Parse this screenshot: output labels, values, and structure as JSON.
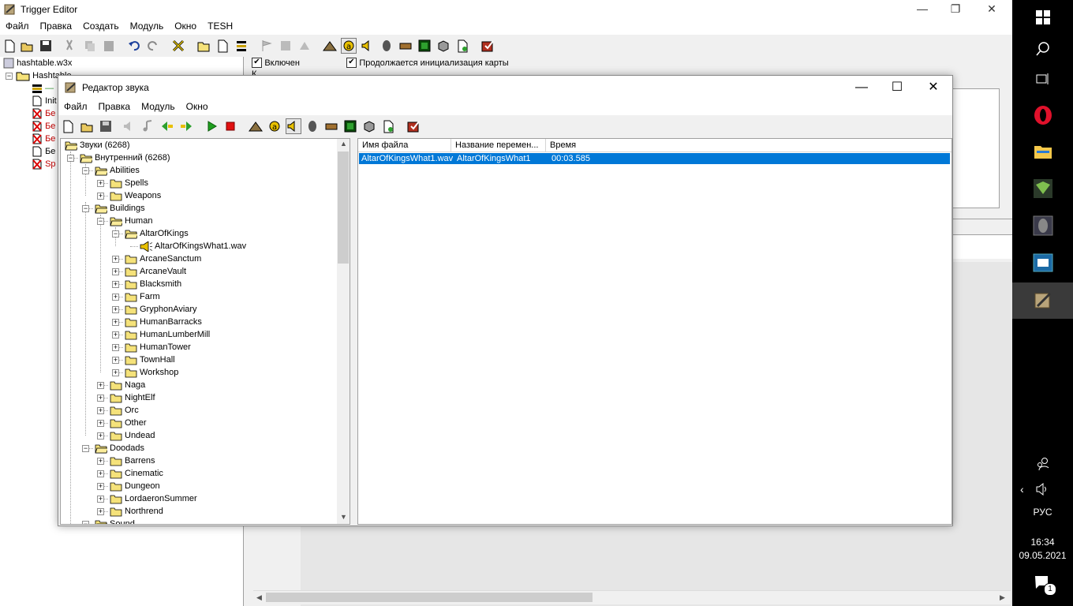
{
  "main": {
    "title": "Trigger Editor",
    "menu": [
      "Файл",
      "Правка",
      "Создать",
      "Модуль",
      "Окно",
      "TESH"
    ],
    "tree": {
      "root": "hashtable.w3x",
      "category": "Hashtable",
      "items": [
        {
          "label": "—",
          "color": "#2e8b2e"
        },
        {
          "label": "Init",
          "color": "#000000"
        },
        {
          "label": "Бе",
          "color": "#c00000"
        },
        {
          "label": "Бе",
          "color": "#c00000"
        },
        {
          "label": "Бе",
          "color": "#c00000"
        },
        {
          "label": "Бе",
          "color": "#000000"
        },
        {
          "label": "Sp",
          "color": "#c00000"
        }
      ]
    },
    "checkbox_enabled": "Включен",
    "checkbox_init": "Продолжается инициализация карты",
    "comment_label": "К"
  },
  "dialog": {
    "title": "Редактор звука",
    "menu": [
      "Файл",
      "Правка",
      "Модуль",
      "Окно"
    ],
    "tree": [
      {
        "label": "Звуки (6268)",
        "level": 0,
        "expander": "",
        "type": "folder-open"
      },
      {
        "label": "Внутренний (6268)",
        "level": 1,
        "expander": "-",
        "type": "folder-open"
      },
      {
        "label": "Abilities",
        "level": 2,
        "expander": "-",
        "type": "folder-open"
      },
      {
        "label": "Spells",
        "level": 3,
        "expander": "+",
        "type": "folder"
      },
      {
        "label": "Weapons",
        "level": 3,
        "expander": "+",
        "type": "folder"
      },
      {
        "label": "Buildings",
        "level": 2,
        "expander": "-",
        "type": "folder-open"
      },
      {
        "label": "Human",
        "level": 3,
        "expander": "-",
        "type": "folder-open"
      },
      {
        "label": "AltarOfKings",
        "level": 4,
        "expander": "-",
        "type": "folder-open"
      },
      {
        "label": "AltarOfKingsWhat1.wav",
        "level": 5,
        "expander": "",
        "type": "sound"
      },
      {
        "label": "ArcaneSanctum",
        "level": 4,
        "expander": "+",
        "type": "folder"
      },
      {
        "label": "ArcaneVault",
        "level": 4,
        "expander": "+",
        "type": "folder"
      },
      {
        "label": "Blacksmith",
        "level": 4,
        "expander": "+",
        "type": "folder"
      },
      {
        "label": "Farm",
        "level": 4,
        "expander": "+",
        "type": "folder"
      },
      {
        "label": "GryphonAviary",
        "level": 4,
        "expander": "+",
        "type": "folder"
      },
      {
        "label": "HumanBarracks",
        "level": 4,
        "expander": "+",
        "type": "folder"
      },
      {
        "label": "HumanLumberMill",
        "level": 4,
        "expander": "+",
        "type": "folder"
      },
      {
        "label": "HumanTower",
        "level": 4,
        "expander": "+",
        "type": "folder"
      },
      {
        "label": "TownHall",
        "level": 4,
        "expander": "+",
        "type": "folder"
      },
      {
        "label": "Workshop",
        "level": 4,
        "expander": "+",
        "type": "folder"
      },
      {
        "label": "Naga",
        "level": 3,
        "expander": "+",
        "type": "folder"
      },
      {
        "label": "NightElf",
        "level": 3,
        "expander": "+",
        "type": "folder"
      },
      {
        "label": "Orc",
        "level": 3,
        "expander": "+",
        "type": "folder"
      },
      {
        "label": "Other",
        "level": 3,
        "expander": "+",
        "type": "folder"
      },
      {
        "label": "Undead",
        "level": 3,
        "expander": "+",
        "type": "folder"
      },
      {
        "label": "Doodads",
        "level": 2,
        "expander": "-",
        "type": "folder-open"
      },
      {
        "label": "Barrens",
        "level": 3,
        "expander": "+",
        "type": "folder"
      },
      {
        "label": "Cinematic",
        "level": 3,
        "expander": "+",
        "type": "folder"
      },
      {
        "label": "Dungeon",
        "level": 3,
        "expander": "+",
        "type": "folder"
      },
      {
        "label": "LordaeronSummer",
        "level": 3,
        "expander": "+",
        "type": "folder"
      },
      {
        "label": "Northrend",
        "level": 3,
        "expander": "+",
        "type": "folder"
      },
      {
        "label": "Sound",
        "level": 2,
        "expander": "-",
        "type": "folder-open"
      }
    ],
    "list": {
      "columns": [
        "Имя файла",
        "Название перемен...",
        "Время"
      ],
      "rows": [
        {
          "file": "AltarOfKingsWhat1.wav",
          "variable": "AltarOfKingsWhat1",
          "time": "00:03.585"
        }
      ]
    }
  },
  "taskbar": {
    "language": "РУС",
    "time": "16:34",
    "date": "09.05.2021",
    "notifications": "1"
  },
  "colors": {
    "selection": "#0078d7",
    "folder": "#f5e27a",
    "taskbar": "#000000"
  }
}
